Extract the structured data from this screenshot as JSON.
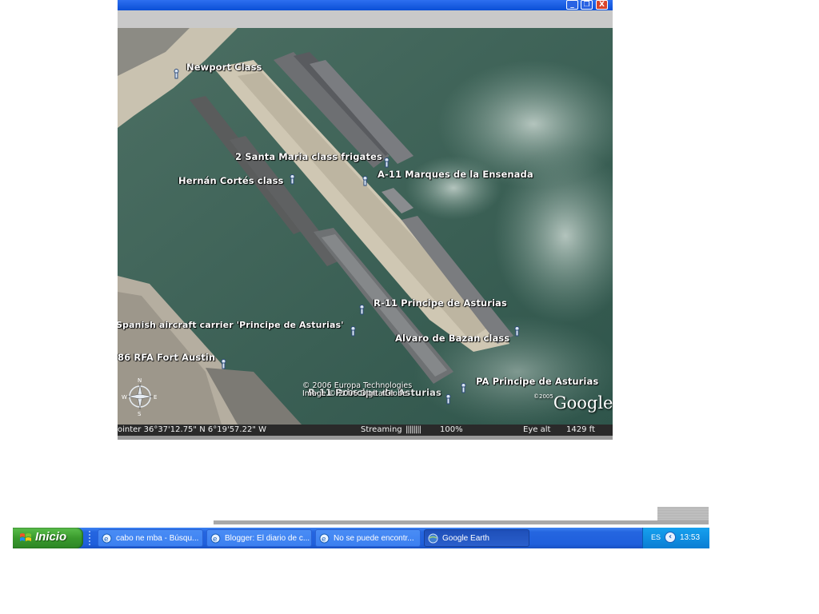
{
  "window": {
    "controls": {
      "minimize_icon": "minimize-icon",
      "maximize_icon": "restore-icon",
      "close_icon": "close-icon"
    }
  },
  "map": {
    "labels": [
      "Newport Class",
      "2 Santa Maria class frigates",
      "A-11 Marques de la Ensenada",
      "Hernán Cortés class",
      "R-11 Principe de Asturias",
      "Spanish aircraft carrier 'Principe de Asturias'",
      "Alvaro de Bazan class",
      "86 RFA Fort Austin",
      "PA Principe de Asturias",
      "R-11 Principe de Asturias"
    ],
    "copyright_line1": "© 2006 Europa Technologies",
    "copyright_line2": "Image © 2006 DigitalGlobe",
    "logo_year": "©2005",
    "logo": "Google",
    "compass_letters": {
      "n": "N",
      "s": "S",
      "e": "E",
      "w": "W"
    }
  },
  "status": {
    "pointer": "ointer  36°37'12.75\"  N    6°19'57.22\"   W",
    "streaming_label": "Streaming",
    "streaming_bars": "||||||||",
    "streaming_percent": "100%",
    "eye_alt_label": "Eye  alt",
    "eye_alt_value": "1429 ft"
  },
  "taskbar": {
    "start_label": "Inicio",
    "tasks": [
      {
        "label": "cabo ne mba - Búsqu...",
        "active": false
      },
      {
        "label": "Blogger: El diario de c...",
        "active": false
      },
      {
        "label": "No se puede encontr...",
        "active": false
      },
      {
        "label": "Google Earth",
        "active": true
      }
    ],
    "language": "ES",
    "clock": "13:53"
  }
}
